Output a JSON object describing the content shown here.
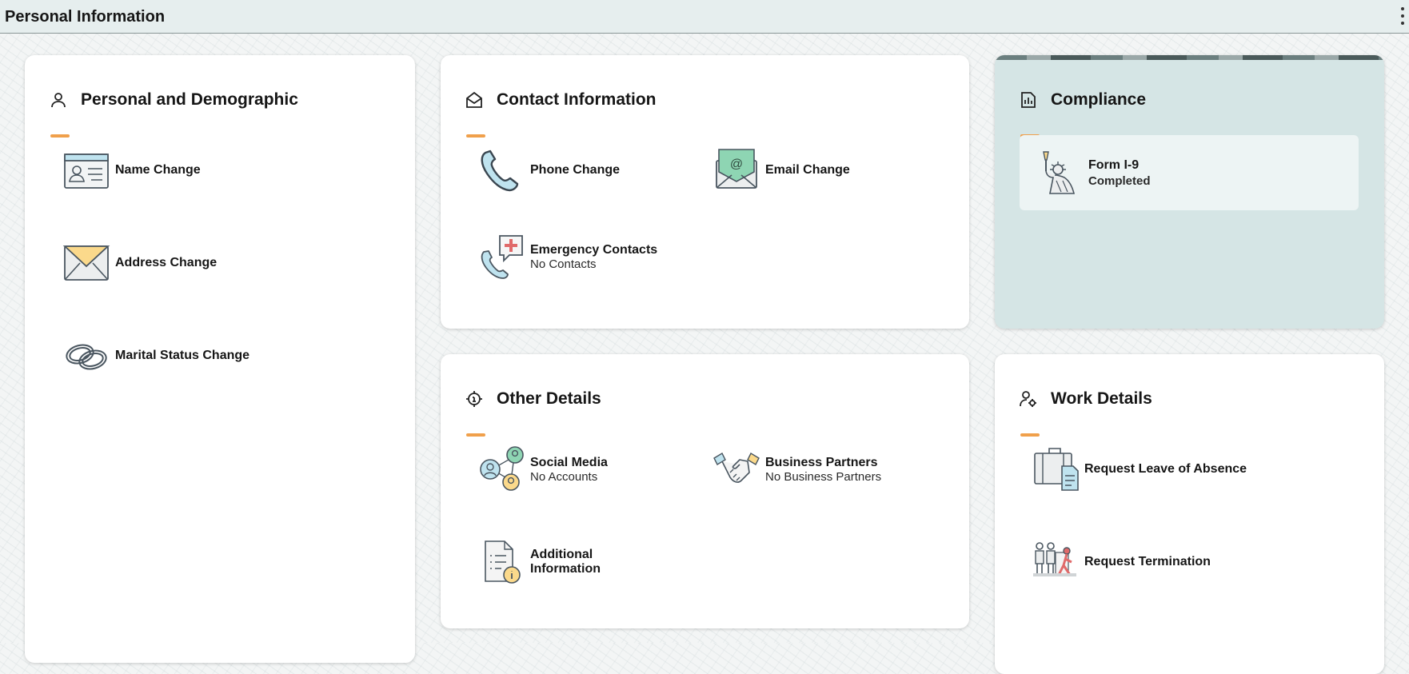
{
  "page": {
    "title": "Personal Information"
  },
  "colors": {
    "accent": "#f0a04b",
    "compliance_bg": "#d5e5e5",
    "card_bg": "#ffffff"
  },
  "cards": {
    "personal": {
      "title": "Personal and Demographic",
      "icon": "person-icon",
      "tiles": [
        {
          "label": "Name Change",
          "icon": "id-card-icon"
        },
        {
          "label": "Address Change",
          "icon": "envelope-icon"
        },
        {
          "label": "Marital Status Change",
          "icon": "rings-icon"
        }
      ]
    },
    "contact": {
      "title": "Contact Information",
      "icon": "open-envelope-icon",
      "tiles": [
        {
          "label": "Phone Change",
          "icon": "phone-icon"
        },
        {
          "label": "Email Change",
          "icon": "email-icon"
        },
        {
          "label": "Emergency Contacts",
          "sub": "No Contacts",
          "icon": "emergency-phone-icon"
        }
      ]
    },
    "compliance": {
      "title": "Compliance",
      "icon": "report-icon",
      "form": {
        "label": "Form I-9",
        "sub": "Completed",
        "icon": "statue-of-liberty-icon"
      }
    },
    "other": {
      "title": "Other Details",
      "icon": "info-target-icon",
      "tiles": [
        {
          "label": "Social Media",
          "sub": "No Accounts",
          "icon": "social-network-icon"
        },
        {
          "label": "Business Partners",
          "sub": "No Business Partners",
          "icon": "handshake-icon"
        },
        {
          "label": "Additional Information",
          "icon": "document-info-icon"
        }
      ]
    },
    "work": {
      "title": "Work Details",
      "icon": "person-gear-icon",
      "tiles": [
        {
          "label": "Request Leave of Absence",
          "icon": "luggage-document-icon"
        },
        {
          "label": "Request Termination",
          "icon": "person-leaving-icon"
        }
      ]
    }
  }
}
